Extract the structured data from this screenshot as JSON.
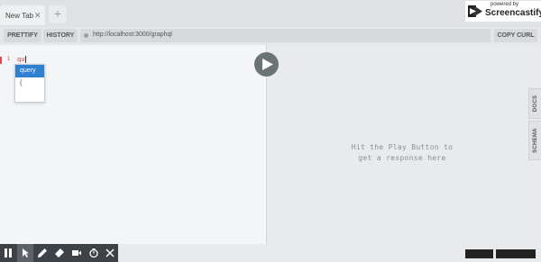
{
  "browser": {
    "tab_label": "New Tab",
    "tab_close": "✕",
    "new_tab": "+"
  },
  "recorder_badge": {
    "small": "powered by",
    "big": "Screencastify"
  },
  "toolbar": {
    "prettify": "PRETTIFY",
    "history": "HISTORY",
    "url": "http://localhost:3000/graphql",
    "copy_curl": "COPY CURL"
  },
  "editor": {
    "line_number": "1",
    "code": "qu",
    "autocomplete": [
      "query",
      "{"
    ]
  },
  "result": {
    "hint_line1": "Hit the Play Button to",
    "hint_line2": "get a response here"
  },
  "side_tabs": {
    "docs": "DOCS",
    "schema": "SCHEMA"
  },
  "colors": {
    "accent": "#2f80d1",
    "play_button": "#6b7377",
    "error_red": "#e04848",
    "recorder_bar": "#3d4247"
  },
  "recorder_controls": [
    "pause-icon",
    "cursor-icon",
    "pen-icon",
    "eraser-icon",
    "camera-icon",
    "timer-icon",
    "close-icon"
  ]
}
